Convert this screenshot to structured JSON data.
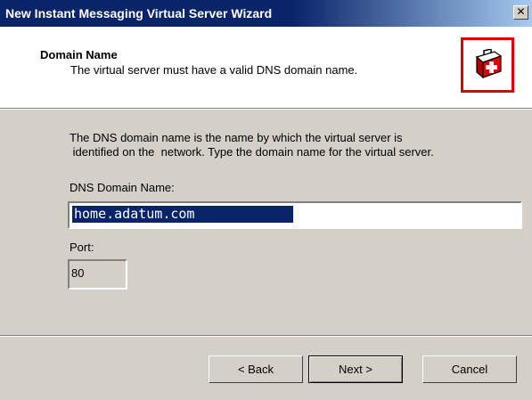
{
  "window": {
    "title": "New Instant Messaging Virtual Server Wizard",
    "close_icon": "close-icon"
  },
  "header": {
    "title": "Domain Name",
    "subtitle": "The virtual server must have a valid DNS domain name.",
    "icon": "first-aid-kit-icon",
    "accent_color": "#e00000"
  },
  "body": {
    "description_line1": "The DNS domain name is the name by which the virtual server is",
    "description_line2": " identified on the  network. Type the domain name for the virtual server.",
    "domain_label": "DNS Domain Name:",
    "domain_value": "home.adatum.com",
    "port_label": "Port:",
    "port_value": "80"
  },
  "buttons": {
    "back": "< Back",
    "next": "Next >",
    "cancel": "Cancel"
  }
}
